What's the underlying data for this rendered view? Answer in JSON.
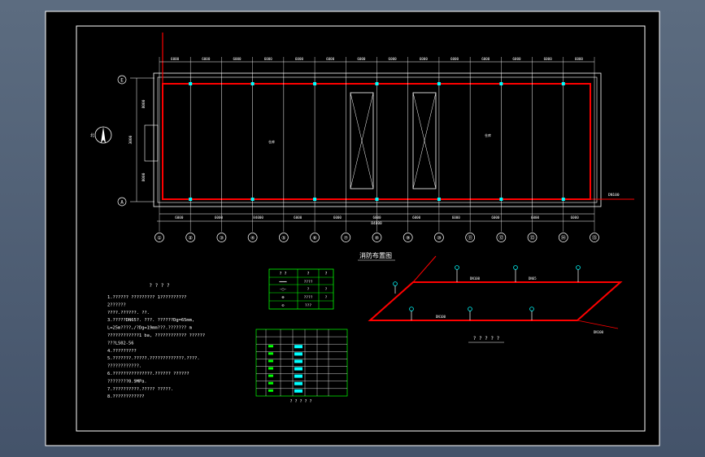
{
  "drawing": {
    "axis_labels": [
      "①",
      "②",
      "③",
      "④",
      "⑤",
      "⑥",
      "⑦",
      "⑧",
      "⑨",
      "⑩",
      "⑪",
      "⑫",
      "⑬",
      "⑭",
      "⑮"
    ],
    "row_labels": [
      "E",
      "A"
    ],
    "top_dims": [
      "6000",
      "6000",
      "6000",
      "6000",
      "6000",
      "6000",
      "6000",
      "6000",
      "6000",
      "6000",
      "6000",
      "6000",
      "6000",
      "6000"
    ],
    "bottom_dims": [
      "6000",
      "6000",
      "84000",
      "6000",
      "6000",
      "6000",
      "6000",
      "6000",
      "6000",
      "6000",
      "6000"
    ],
    "total_dim": "84000",
    "left_dims": [
      "8000",
      "3000",
      "8000"
    ],
    "plan_title": "消防布置图",
    "pipe_note": "DN100",
    "room_label": "仓库",
    "north_label": "北",
    "legend": {
      "headers": [
        "?  ?",
        "?",
        "?"
      ],
      "rows": [
        [
          "━━━",
          "????",
          ""
        ],
        [
          "-○-",
          "?",
          "?"
        ],
        [
          "⊗",
          "????",
          "?"
        ],
        [
          "⊙",
          "???",
          ""
        ]
      ]
    },
    "notes": {
      "title": "? ? ? ?",
      "lines": [
        "1.??????  ?????????   1??????????",
        "  2??????",
        "    ????.??????.  ??.",
        "3.?????DN65?.  ???. ??????Dg=65mm,",
        "   L=25m????,/?Dg=19mm???.??????? m",
        "   ????????????1 ba,   ????????????   ??????",
        "   ???LS02-56",
        "4.?????????",
        "5.???????.?????.?????????????.????.",
        "   ????????????.",
        "6.???????????????.??????       ??????",
        "   ????????0.9MPa.",
        "7.??????????.?????     ?????.",
        "8.????????????"
      ]
    },
    "table_title": "? ? ? ? ?",
    "iso": {
      "title": "? ? ? ? ?",
      "labels": [
        "DN100",
        "DN65",
        "DN100",
        "DN100",
        "DN100",
        "DN100"
      ]
    }
  },
  "colors": {
    "frame": "#ffffff",
    "pipe": "#ff0000",
    "grid": "#ffffff",
    "accent": "#00ffff",
    "green": "#00ff00",
    "paper": "#000000"
  }
}
